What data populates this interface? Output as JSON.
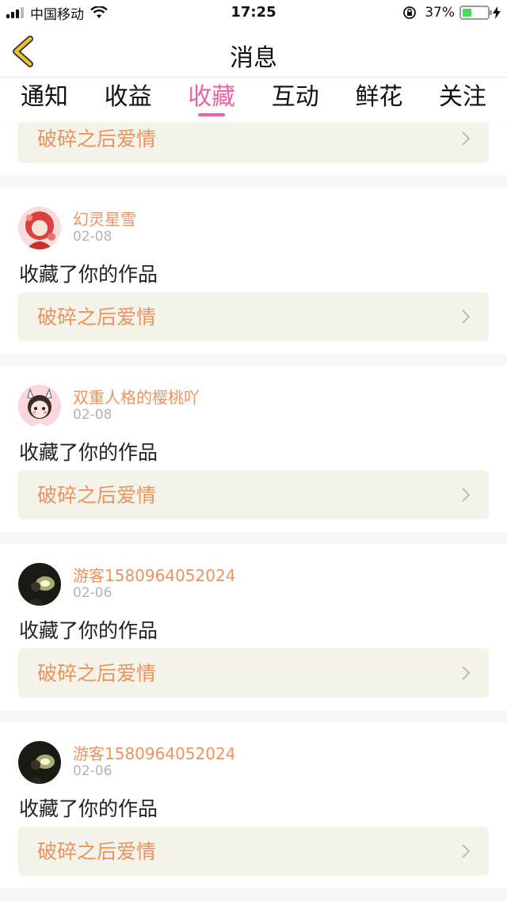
{
  "status_bar": {
    "carrier": "中国移动",
    "time": "17:25",
    "battery_percent": "37%",
    "battery_level": 0.37,
    "icons": [
      "signal-icon",
      "wifi-icon",
      "rotation-lock-icon",
      "battery-icon",
      "charging-icon"
    ]
  },
  "nav": {
    "title": "消息",
    "back_icon": "back-chevron-icon"
  },
  "tabs": [
    {
      "label": "通知",
      "active": false
    },
    {
      "label": "收益",
      "active": false
    },
    {
      "label": "收藏",
      "active": true
    },
    {
      "label": "互动",
      "active": false
    },
    {
      "label": "鲜花",
      "active": false
    },
    {
      "label": "关注",
      "active": false
    }
  ],
  "partial_item": {
    "work_title": "破碎之后爱情"
  },
  "items": [
    {
      "user": "幻灵星雪",
      "date": "02-08",
      "action": "收藏了你的作品",
      "work_title": "破碎之后爱情",
      "avatar": "red-anime-avatar"
    },
    {
      "user": "双重人格的樱桃吖",
      "date": "02-08",
      "action": "收藏了你的作品",
      "work_title": "破碎之后爱情",
      "avatar": "cartoon-girl-avatar"
    },
    {
      "user": "游客1580964052024",
      "date": "02-06",
      "action": "收藏了你的作品",
      "work_title": "破碎之后爱情",
      "avatar": "dark-guest-avatar"
    },
    {
      "user": "游客1580964052024",
      "date": "02-06",
      "action": "收藏了你的作品",
      "work_title": "破碎之后爱情",
      "avatar": "dark-guest-avatar"
    }
  ],
  "colors": {
    "accent_pink": "#e466a6",
    "user_orange": "#ea9560",
    "work_bg": "#f3f3ea",
    "back_arrow": "#f0c030"
  }
}
